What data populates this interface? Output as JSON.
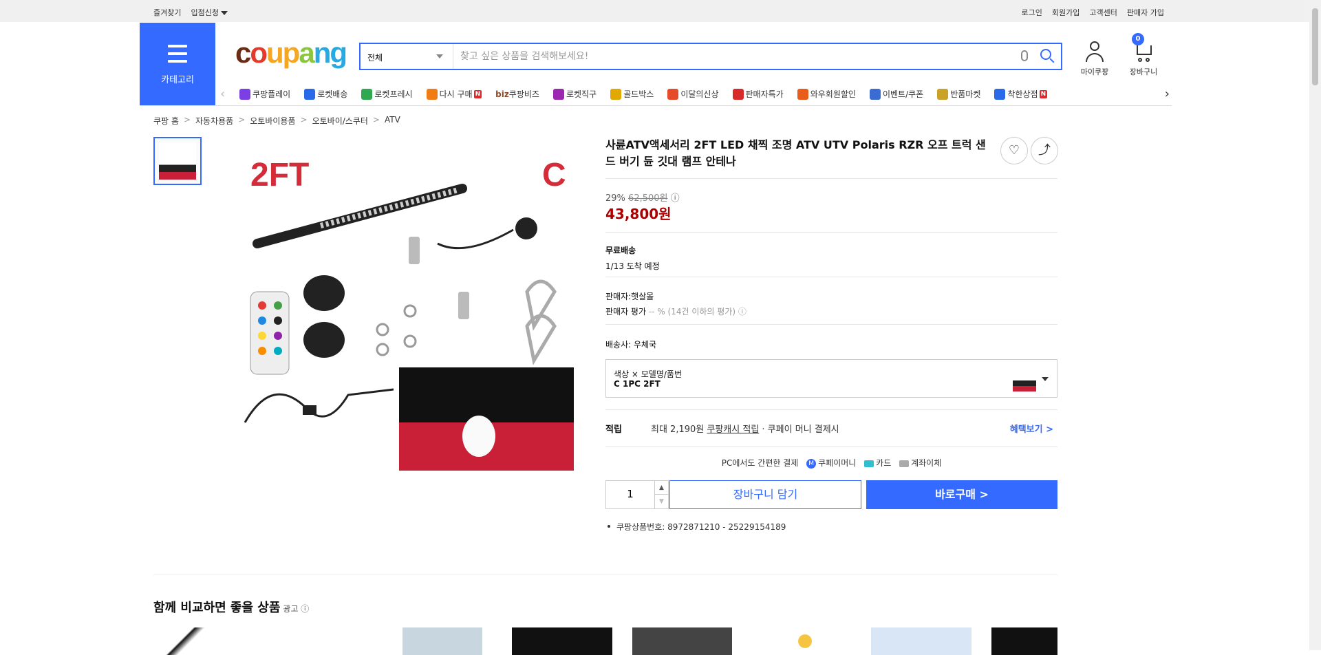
{
  "topbar": {
    "left": [
      "즐겨찾기",
      "입점신청"
    ],
    "right": [
      "로그인",
      "회원가입",
      "고객센터",
      "판매자 가입"
    ]
  },
  "header": {
    "category_label": "카테고리",
    "logo": "coupang",
    "search": {
      "scope": "전체",
      "placeholder": "찾고 싶은 상품을 검색해보세요!"
    },
    "mycoupang_label": "마이쿠팡",
    "cart_label": "장바구니",
    "cart_count": "0"
  },
  "nav": {
    "items": [
      {
        "label": "쿠팡플레이",
        "icon": "play-icon",
        "color": "#7b3fe4"
      },
      {
        "label": "로켓배송",
        "icon": "rocket-icon",
        "color": "#2a6ae8"
      },
      {
        "label": "로켓프레시",
        "icon": "rocket-fresh-icon",
        "color": "#2fa84f"
      },
      {
        "label": "다시 구매",
        "icon": "rebuy-icon",
        "color": "#f07c16",
        "badge": "N"
      },
      {
        "label": "쿠팡비즈",
        "icon": "biz-icon",
        "color": "#8b4b2a",
        "prefix": "biz"
      },
      {
        "label": "로켓직구",
        "icon": "global-icon",
        "color": "#9c27b0"
      },
      {
        "label": "골드박스",
        "icon": "goldbox-icon",
        "color": "#e0a800"
      },
      {
        "label": "이달의신상",
        "icon": "new-icon",
        "color": "#e54b2b"
      },
      {
        "label": "판매자특가",
        "icon": "percent-icon",
        "color": "#d72b2b"
      },
      {
        "label": "와우회원할인",
        "icon": "wow-icon",
        "color": "#e85d1a"
      },
      {
        "label": "이벤트/쿠폰",
        "icon": "coupon-icon",
        "color": "#3b6cd1"
      },
      {
        "label": "반품마켓",
        "icon": "return-market-icon",
        "color": "#c9a227"
      },
      {
        "label": "착한상점",
        "icon": "good-store-icon",
        "color": "#2a6ae8",
        "badge": "N"
      }
    ]
  },
  "breadcrumb": [
    "쿠팡 홈",
    "자동차용품",
    "오토바이용품",
    "오토바이/스쿠터",
    "ATV"
  ],
  "product": {
    "title": "사륜ATV액세서리 2FT LED 채찍 조명 ATV UTV Polaris RZR 오프 트럭 샌드 버기 듄 깃대 램프 안테나",
    "image_labels": {
      "left": "2FT",
      "right": "C"
    },
    "discount": "29%",
    "original_price": "62,500원",
    "sale_price": "43,800원",
    "shipping_title": "무료배송",
    "arrival": "1/13 도착 예정",
    "seller": "판매자:햇살몰",
    "seller_rating_label": "판매자 평가",
    "seller_rating_value": "-- % (14건 이하의 평가)",
    "carrier": "배송사:  우체국",
    "option_label": "색상 × 모델명/품번",
    "option_value": "C 1PC 2FT",
    "reward_label": "적립",
    "reward_prefix": "최대 2,190원",
    "reward_link": "쿠팡캐시 적립",
    "reward_suffix": "· 쿠페이 머니 결제시",
    "reward_more": "혜택보기 >",
    "pay_title": "PC에서도 간편한 결제",
    "pay_methods": [
      "쿠페이머니",
      "카드",
      "계좌이체"
    ],
    "quantity": "1",
    "add_to_cart": "장바구니 담기",
    "buy_now": "바로구매 >",
    "product_no": "쿠팡상품번호: 8972871210 - 25229154189"
  },
  "recommend": {
    "title": "함께 비교하면 좋을 상품",
    "ad": "광고 ⓘ"
  }
}
